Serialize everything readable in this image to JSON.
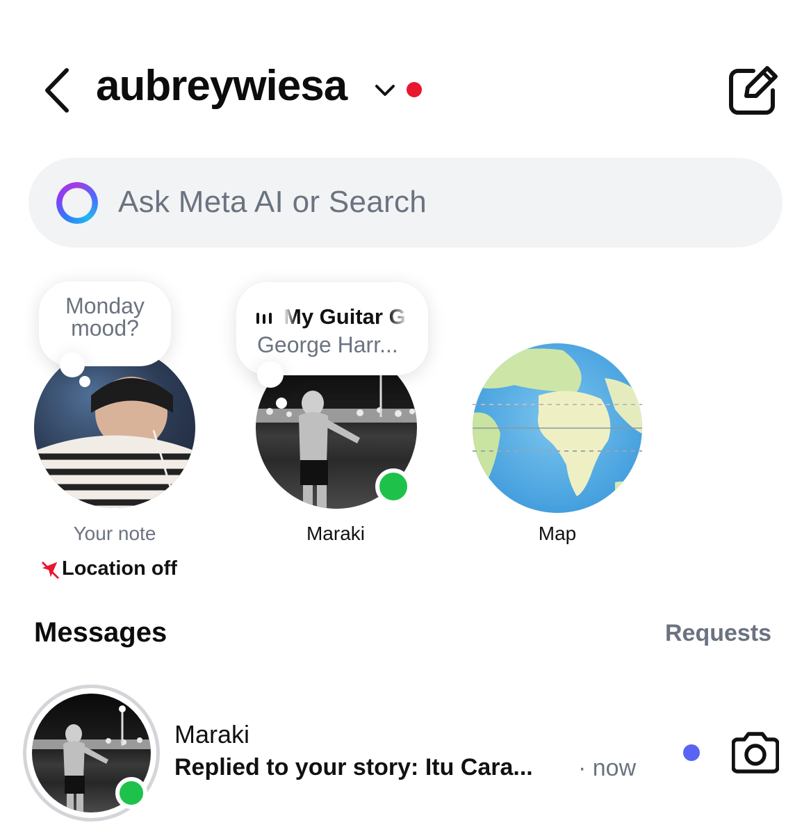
{
  "header": {
    "username": "aubreywiesa",
    "status_dot_color": "#e8162f",
    "icons": {
      "back": "chevron-left-icon",
      "switch": "chevron-down-icon",
      "compose": "compose-icon"
    }
  },
  "search": {
    "placeholder": "Ask Meta AI or Search",
    "icon": "meta-ai-ring-icon"
  },
  "notes": [
    {
      "label": "Your note",
      "bubble_text": "Monday mood?",
      "sub_label": "Location off",
      "sub_icon": "location-off-icon",
      "sub_icon_color": "#e8162f"
    },
    {
      "label": "Maraki",
      "song_title": "My Guitar G",
      "song_artist": "George Harr...",
      "music_icon": "sound-bars-icon",
      "online": true
    },
    {
      "label": "Map",
      "icon": "globe-map-icon"
    }
  ],
  "messages": {
    "title": "Messages",
    "requests_label": "Requests",
    "threads": [
      {
        "name": "Maraki",
        "preview": "Replied to your story: Itu Cara...",
        "time": "· now",
        "unread": true,
        "unread_color": "#5865f2",
        "online": true,
        "action_icon": "camera-icon"
      }
    ]
  },
  "colors": {
    "online": "#1ec24a",
    "muted_text": "#6b7380",
    "search_bg": "#f2f3f5"
  }
}
